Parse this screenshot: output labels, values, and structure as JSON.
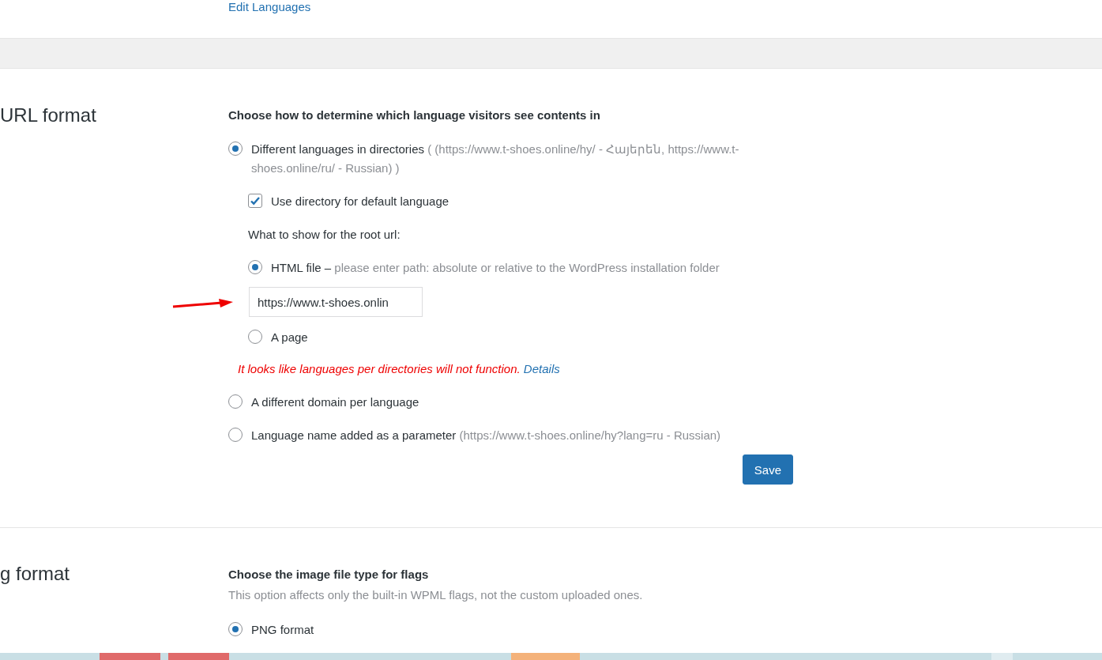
{
  "top_link": "Edit Languages",
  "url_format": {
    "heading": "URL format",
    "title": "Choose how to determine which language visitors see contents in",
    "options": [
      {
        "label": "Different languages in directories",
        "hint": "( (https://www.t-shoes.online/hy/ - Հայերեն, https://www.t-shoes.online/ru/ - Russian) )",
        "selected": true,
        "sub": {
          "directory_checkbox": {
            "label": "Use directory for default language",
            "checked": true
          },
          "root_label": "What to show for the root url:",
          "root_options": [
            {
              "label": "HTML file –",
              "hint": "please enter path: absolute or relative to the WordPress installation folder",
              "selected": true,
              "field_value": "https://www.t-shoes.onlin"
            },
            {
              "label": "A page",
              "selected": false
            }
          ],
          "warning": {
            "text": "It looks like languages per directories will not function.",
            "link": "Details"
          }
        }
      },
      {
        "label": "A different domain per language",
        "selected": false
      },
      {
        "label": "Language name added as a parameter",
        "hint": "(https://www.t-shoes.online/hy?lang=ru - Russian)",
        "selected": false
      }
    ],
    "save": "Save"
  },
  "flag_format": {
    "heading": "g format",
    "title": "Choose the image file type for flags",
    "description": "This option affects only the built-in WPML flags, not the custom uploaded ones.",
    "options": [
      {
        "label": "PNG format",
        "selected": true
      }
    ]
  }
}
